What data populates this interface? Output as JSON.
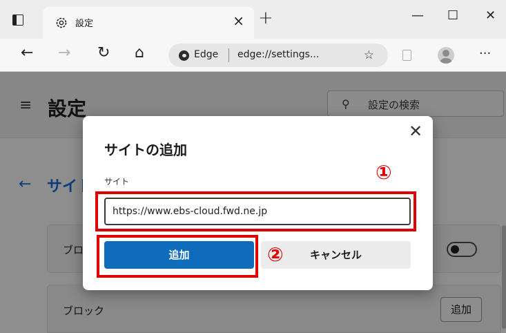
{
  "browser": {
    "tab": {
      "title": "設定",
      "close_glyph": "×"
    },
    "new_tab_glyph": "+",
    "window_controls": {
      "minimize": "—",
      "maximize": "☐",
      "close": "✕"
    },
    "nav": {
      "back": "←",
      "forward": "→",
      "refresh": "↻",
      "home": "⌂"
    },
    "address_bar": {
      "badge": "Edge",
      "url": "edge://settings..."
    },
    "more_glyph": "···"
  },
  "settings": {
    "menu_glyph": "≡",
    "title": "設定",
    "search_placeholder": "設定の検索",
    "breadcrumb": "サイト",
    "card1_label": "ブロ",
    "card2_label": "ブロック",
    "card2_button": "追加"
  },
  "dialog": {
    "title": "サイトの追加",
    "close_glyph": "✕",
    "field_label": "サイト",
    "site_value": "https://www.ebs-cloud.fwd.ne.jp",
    "add_button": "追加",
    "cancel_button": "キャンセル"
  },
  "annotations": {
    "marker1": "①",
    "marker2": "②",
    "color": "#e10000"
  }
}
